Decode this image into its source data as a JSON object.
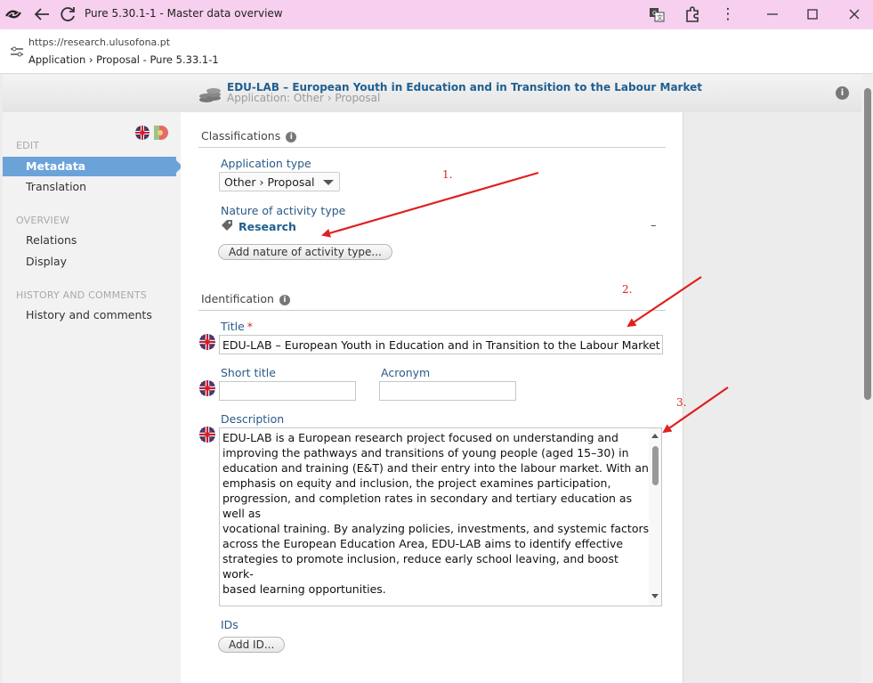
{
  "browser": {
    "window_title": "Pure 5.30.1-1 - Master data overview",
    "url": "https://research.ulusofona.pt",
    "page_crumb": "Application › Proposal - Pure 5.33.1-1"
  },
  "header": {
    "title": "EDU-LAB – European Youth in Education and in Transition to the Labour Market",
    "subtitle": "Application: Other › Proposal"
  },
  "sidebar": {
    "edit_label": "EDIT",
    "metadata": "Metadata",
    "translation": "Translation",
    "overview_label": "OVERVIEW",
    "relations": "Relations",
    "display": "Display",
    "history_label": "HISTORY AND COMMENTS",
    "history": "History and comments"
  },
  "classifications": {
    "heading": "Classifications",
    "application_type_label": "Application type",
    "application_type_value": "Other › Proposal",
    "nature_label": "Nature of activity type",
    "nature_value": "Research",
    "remove_symbol": "–",
    "add_nature_button": "Add nature of activity type..."
  },
  "identification": {
    "heading": "Identification",
    "title_label": "Title",
    "required_mark": "*",
    "title_value": "EDU-LAB – European Youth in Education and in Transition to the Labour Market",
    "short_title_label": "Short title",
    "short_title_value": "",
    "acronym_label": "Acronym",
    "acronym_value": "",
    "description_label": "Description",
    "description_value": "EDU-LAB is a European research project focused on understanding and\nimproving the pathways and transitions of young people (aged 15–30) in\neducation and training (E&T) and their entry into the labour market. With an\nemphasis on equity and inclusion, the project examines participation,\nprogression, and completion rates in secondary and tertiary education as well as\nvocational training. By analyzing policies, investments, and systemic factors\nacross the European Education Area, EDU-LAB aims to identify effective\nstrategies to promote inclusion, reduce early school leaving, and boost work-\nbased learning opportunities.\n\nEDU-LAB will develop comprehensive models of pathways and transitions per\ncountry in the European Education Area (EEA) including their intersectional and",
    "ids_label": "IDs",
    "add_id_button": "Add ID..."
  },
  "annotations": [
    "1.",
    "2.",
    "3."
  ],
  "colors": {
    "accent": "#6ba3d9",
    "link": "#2b5a88",
    "annotation": "#e02020",
    "titlebar": "#f6d0ee"
  }
}
